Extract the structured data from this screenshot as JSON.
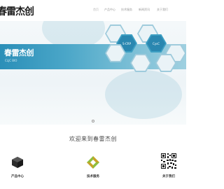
{
  "header": {
    "logo_text": "春雷杰创",
    "nav": [
      {
        "label": "首页",
        "active": true
      },
      {
        "label": "产品中心",
        "active": false
      },
      {
        "label": "技术服务",
        "active": false
      },
      {
        "label": "新闻资讯",
        "active": false
      },
      {
        "label": "关于我们",
        "active": false
      }
    ]
  },
  "banner": {
    "title": "春雷杰创",
    "subtitle": "CLJC BIO",
    "hexagons": [
      "S-CRP",
      "CysC"
    ],
    "colors": {
      "accent": "#2b8fb8",
      "accent_light": "#6db8d2"
    }
  },
  "welcome": "欢迎来到春雷杰创",
  "features": [
    {
      "label": "产品中心",
      "icon": "dark-cube-icon"
    },
    {
      "label": "技术服务",
      "icon": "green-gold-diamond-icon"
    },
    {
      "label": "关于我们",
      "icon": "qr-code-icon"
    }
  ]
}
